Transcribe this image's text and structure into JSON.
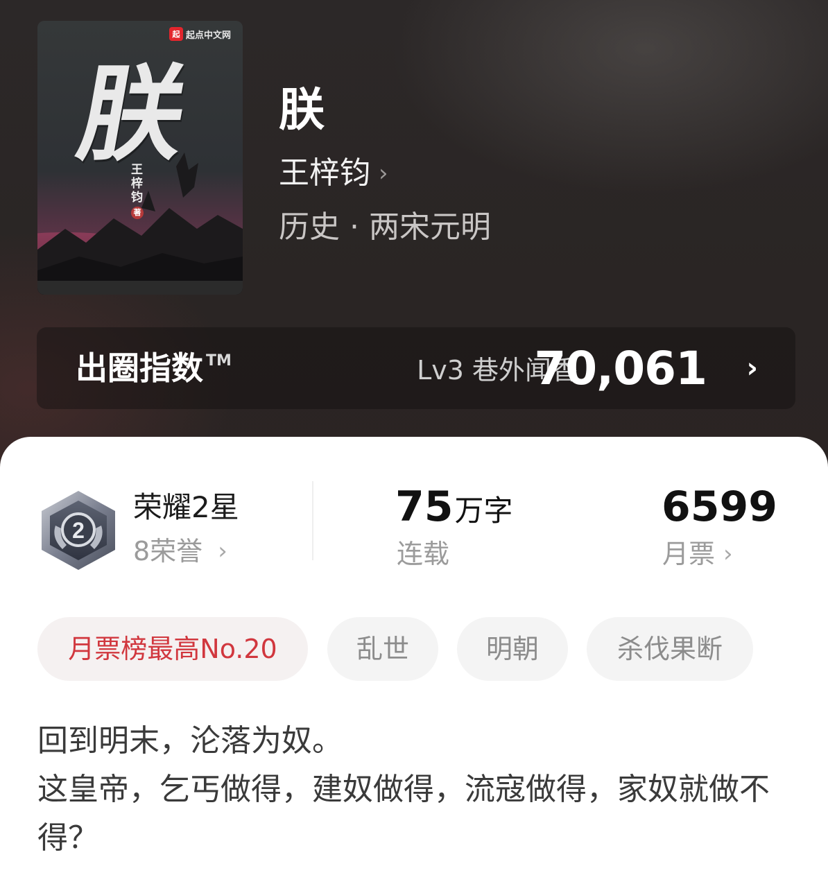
{
  "book": {
    "title": "朕",
    "author": "王梓钧",
    "author_chevron": "›",
    "category": "历史 · 两宋元明",
    "cover": {
      "logo_mark": "起",
      "logo_text": "起点中文网",
      "title_char": "朕",
      "author_vertical": "王梓钧",
      "author_badge": "著"
    }
  },
  "index_card": {
    "label": "出圈指数",
    "tm": "TM",
    "level": "Lv3 巷外闻香",
    "value": "70,061",
    "chevron": "›"
  },
  "honor": {
    "badge_number": "2",
    "title": "荣耀2星",
    "subtitle": "8荣誉",
    "chevron": "›"
  },
  "stats": {
    "words_number": "75",
    "words_unit": "万字",
    "words_label": "连载",
    "votes_value": "6599",
    "votes_label": "月票",
    "chevron": "›"
  },
  "tags": [
    {
      "label": "月票榜最高No.20",
      "color": "#d1373e"
    },
    {
      "label": "乱世"
    },
    {
      "label": "明朝"
    },
    {
      "label": "杀伐果断"
    }
  ],
  "synopsis": "回到明末，沦落为奴。\n这皇帝，乞丐做得，建奴做得，流寇做得，家奴就做不得？"
}
